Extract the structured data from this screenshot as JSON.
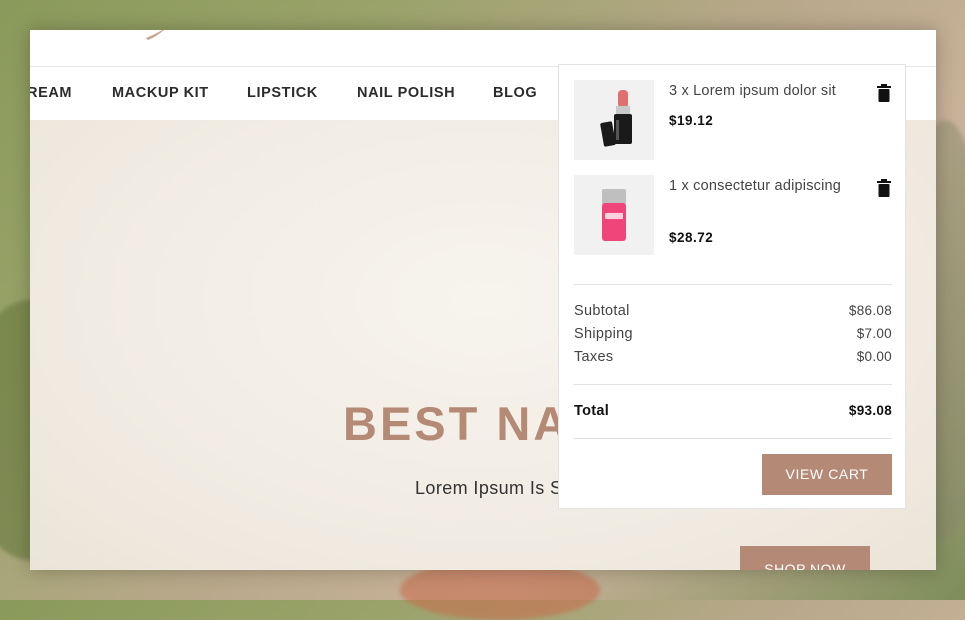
{
  "nav": {
    "items": [
      "REAM",
      "MACKUP KIT",
      "LIPSTICK",
      "NAIL POLISH",
      "BLOG"
    ]
  },
  "hero": {
    "title": "BEST NAT",
    "subtitle": "Lorem Ipsum Is S",
    "button_label": "SHOP NOW"
  },
  "cart": {
    "items": [
      {
        "name": "3 x Lorem ipsum dolor sit",
        "price": "$19.12",
        "icon": "lipstick-image"
      },
      {
        "name": "1 x consectetur adipiscing",
        "price": "$28.72",
        "icon": "cosmetic-jar-image"
      }
    ],
    "subtotal_label": "Subtotal",
    "subtotal_value": "$86.08",
    "shipping_label": "Shipping",
    "shipping_value": "$7.00",
    "taxes_label": "Taxes",
    "taxes_value": "$0.00",
    "total_label": "Total",
    "total_value": "$93.08",
    "view_cart_label": "VIEW CART"
  },
  "colors": {
    "accent": "#b48a76",
    "text_dark": "#2b2b2b"
  }
}
